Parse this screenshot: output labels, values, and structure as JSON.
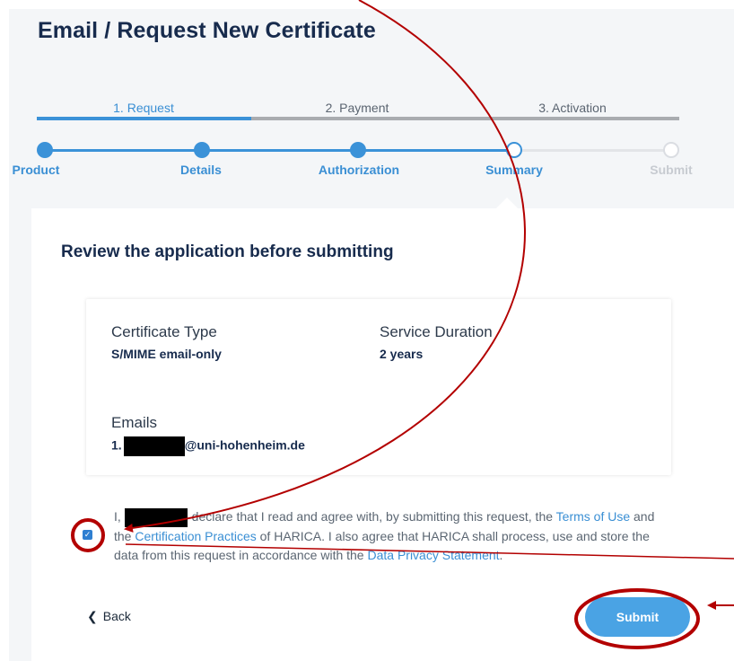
{
  "page": {
    "title": "Email / Request New Certificate"
  },
  "steps": [
    {
      "label": "1. Request",
      "state": "active"
    },
    {
      "label": "2. Payment",
      "state": "inactive"
    },
    {
      "label": "3. Activation",
      "state": "inactive"
    }
  ],
  "substeps": [
    {
      "label": "Product",
      "state": "done"
    },
    {
      "label": "Details",
      "state": "done"
    },
    {
      "label": "Authorization",
      "state": "done"
    },
    {
      "label": "Summary",
      "state": "current"
    },
    {
      "label": "Submit",
      "state": "future"
    }
  ],
  "review": {
    "title": "Review the application before submitting",
    "certificate_type_label": "Certificate Type",
    "certificate_type_value": "S/MIME email-only",
    "service_duration_label": "Service Duration",
    "service_duration_value": "2 years",
    "emails_label": "Emails",
    "email_prefix": "1.",
    "email_domain": "@uni-hohenheim.de"
  },
  "consent": {
    "prefix": "I,",
    "text1": " declare that I read and agree with, by submitting this request, the ",
    "terms_link": "Terms of Use",
    "text2": " and the ",
    "cp_link": "Certification Practices",
    "text3": " of HARICA. I also agree that HARICA shall process, use and store the data from this request in accordance with the ",
    "privacy_link": "Data Privacy Statement",
    "text4": ".",
    "checked": true
  },
  "actions": {
    "back_label": "Back",
    "submit_label": "Submit"
  },
  "colors": {
    "accent": "#3b92d8",
    "annotation": "#b30000",
    "button": "#4aa3e4"
  }
}
